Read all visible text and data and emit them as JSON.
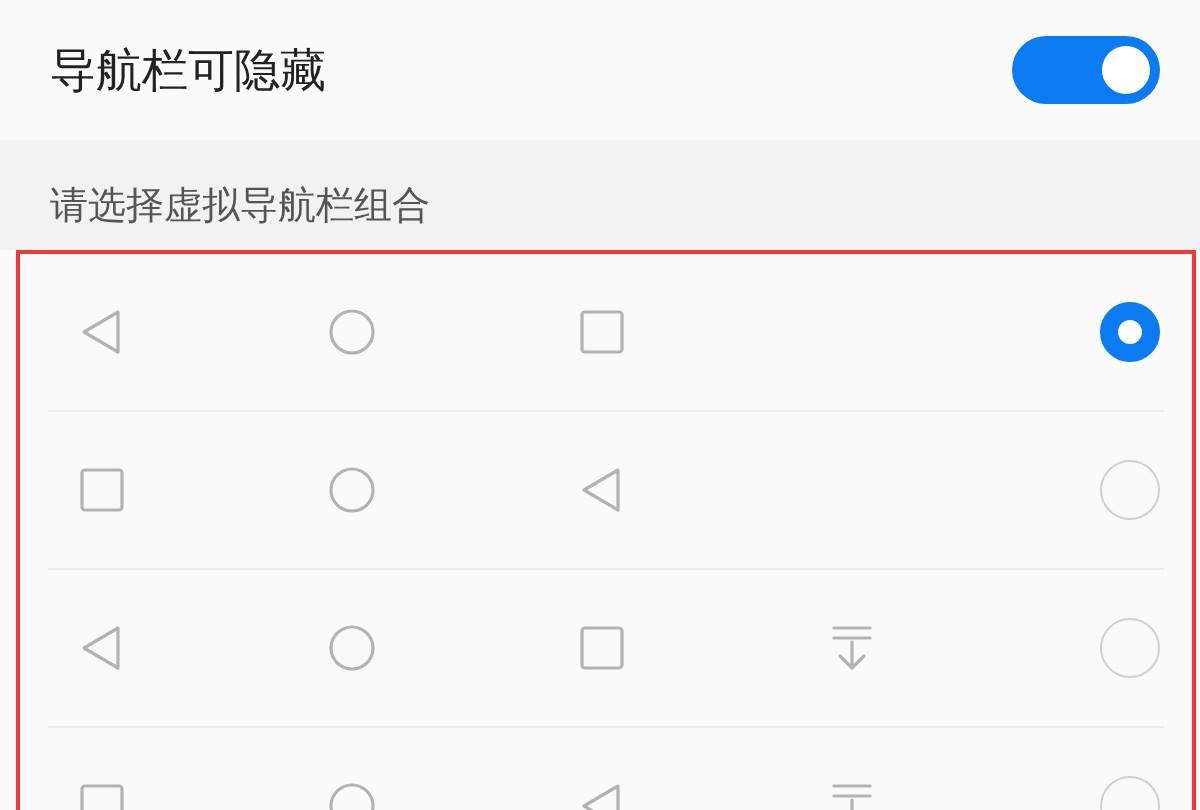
{
  "setting": {
    "label": "导航栏可隐藏",
    "on": true
  },
  "section_header": "请选择虚拟导航栏组合",
  "options": [
    {
      "selected": true,
      "keys": [
        {
          "kind": "back"
        },
        {
          "kind": "home"
        },
        {
          "kind": "recent"
        }
      ]
    },
    {
      "selected": false,
      "keys": [
        {
          "kind": "recent"
        },
        {
          "kind": "home"
        },
        {
          "kind": "back"
        }
      ]
    },
    {
      "selected": false,
      "keys": [
        {
          "kind": "back"
        },
        {
          "kind": "home"
        },
        {
          "kind": "recent"
        },
        {
          "kind": "hide"
        }
      ]
    },
    {
      "selected": false,
      "keys": [
        {
          "kind": "recent"
        },
        {
          "kind": "home"
        },
        {
          "kind": "back"
        },
        {
          "kind": "hide"
        }
      ]
    }
  ]
}
